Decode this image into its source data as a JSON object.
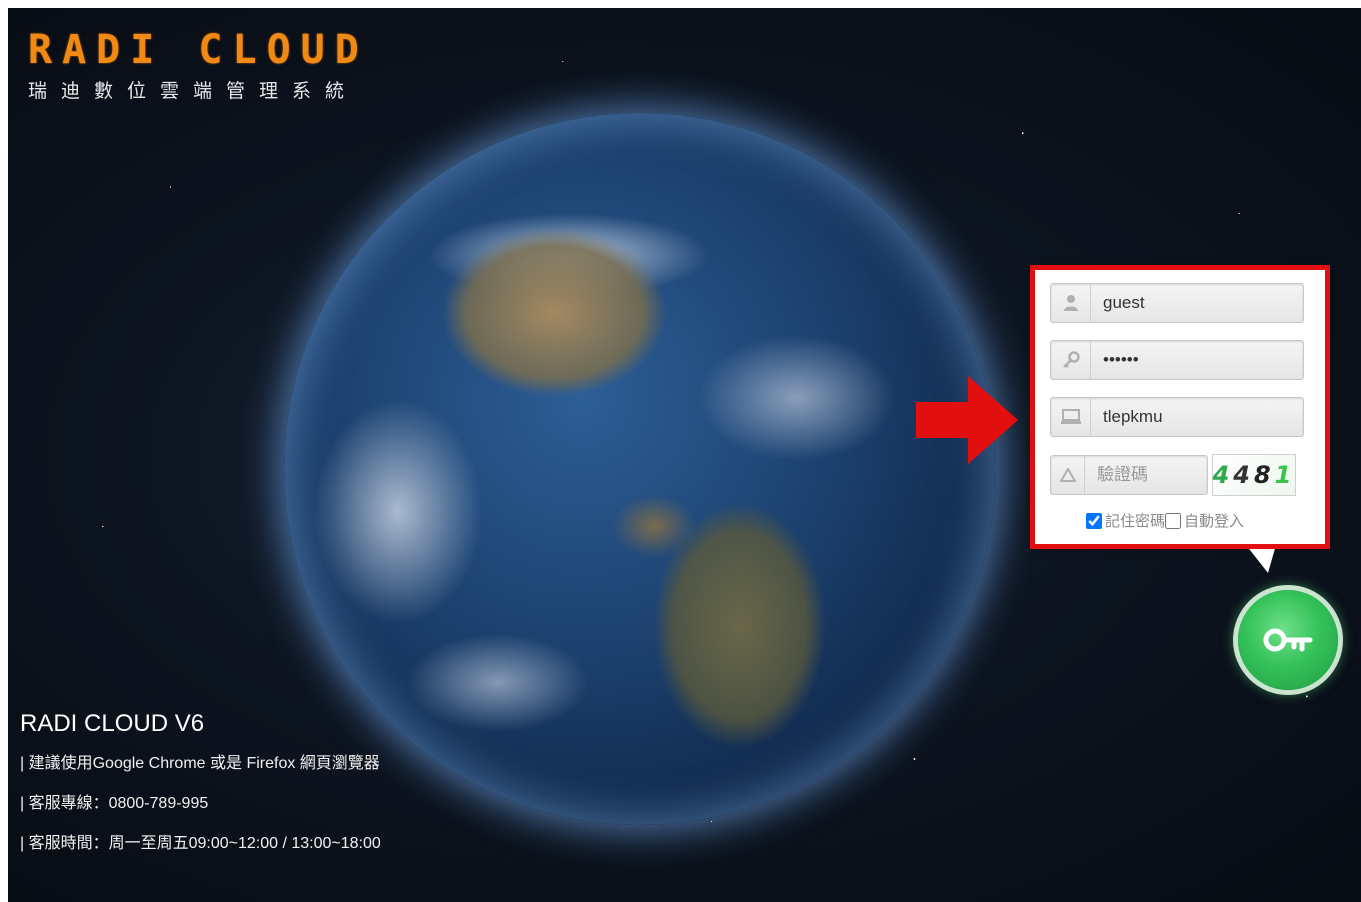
{
  "brand": {
    "logo_text": "RADI CLOUD",
    "subtitle": "瑞迪數位雲端管理系統",
    "accent_color": "#f08a14"
  },
  "footer": {
    "version": "RADI CLOUD V6",
    "browser_note": "| 建議使用Google Chrome 或是 Firefox 網頁瀏覽器",
    "hotline": "| 客服專線：0800-789-995",
    "hours": "| 客服時間：周一至周五09:00~12:00 / 13:00~18:00"
  },
  "login": {
    "username": {
      "value": "guest",
      "icon": "user-icon"
    },
    "password": {
      "value": "••••••",
      "icon": "key-icon"
    },
    "company": {
      "value": "tlepkmu",
      "icon": "computer-icon"
    },
    "captcha": {
      "placeholder": "驗證碼",
      "icon": "captcha-icon",
      "image_text": [
        "4",
        "4",
        "8",
        "1"
      ]
    },
    "remember_password": {
      "label": "記住密碼",
      "checked": true
    },
    "auto_login": {
      "label": "自動登入",
      "checked": false
    },
    "submit_icon": "key-icon"
  },
  "annotation": {
    "arrow_color": "#e20f10",
    "highlight_color": "#e20f10"
  }
}
